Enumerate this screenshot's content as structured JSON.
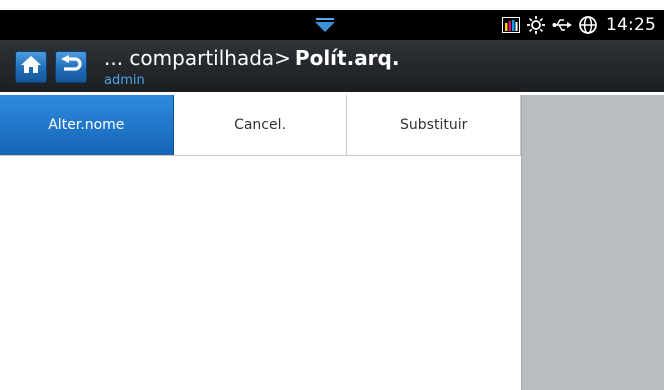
{
  "status_bar": {
    "time": "14:25",
    "icons": [
      "pull-down-handle-icon",
      "toner-level-icon",
      "eco-sun-icon",
      "usb-icon",
      "network-globe-icon"
    ]
  },
  "header": {
    "path": "... compartilhada>",
    "current": "Polít.arq.",
    "user": "admin"
  },
  "tabs": [
    {
      "label": "Alter.nome",
      "active": true
    },
    {
      "label": "Cancel.",
      "active": false
    },
    {
      "label": "Substituir",
      "active": false
    }
  ],
  "colors": {
    "accent": "#1f6db8",
    "active_tab": "#1e78cf",
    "header_bg": "#22262a",
    "side_panel": "#b9bdc1",
    "user_text": "#4aa3e8"
  }
}
